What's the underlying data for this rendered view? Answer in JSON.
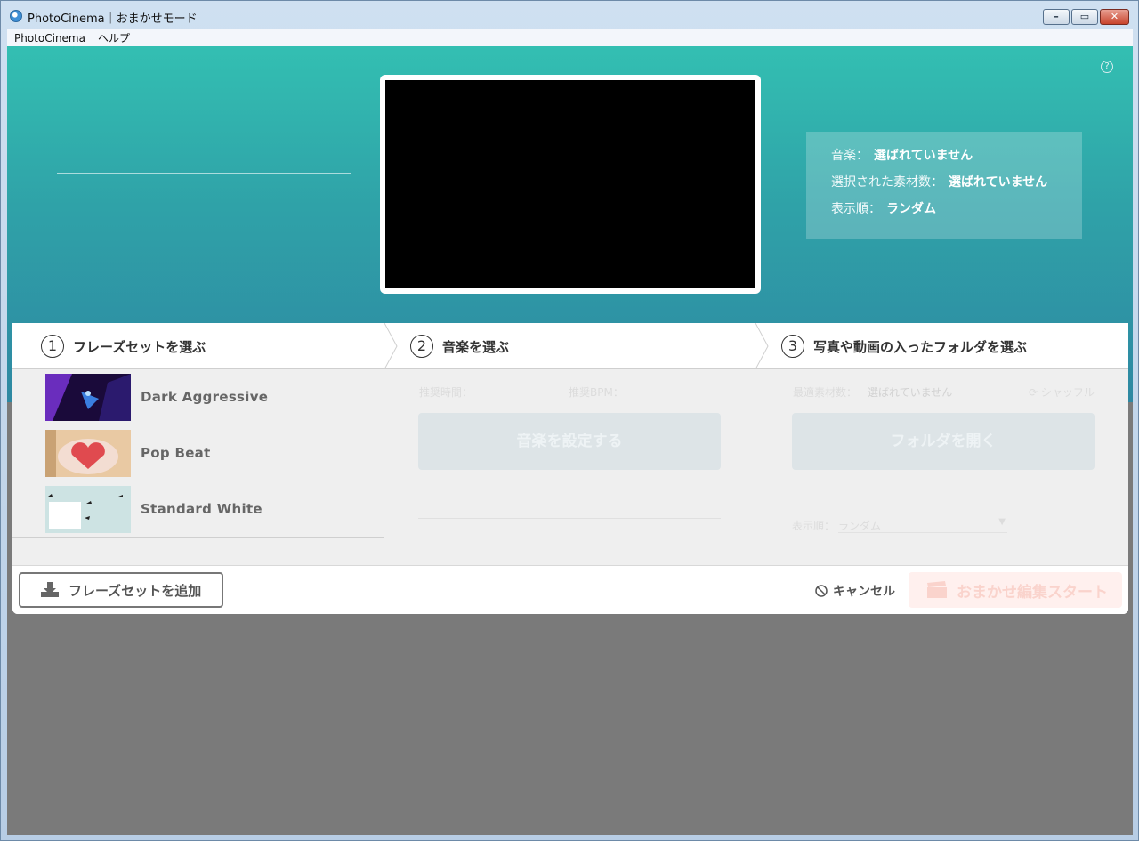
{
  "window": {
    "title": "PhotoCinema｜おまかせモード"
  },
  "menu": {
    "items": [
      "PhotoCinema",
      "ヘルプ"
    ]
  },
  "hero": {
    "help": "?",
    "info": {
      "music_label": "音楽：",
      "music_value": "選ばれていません",
      "count_label": "選択された素材数：",
      "count_value": "選ばれていません",
      "order_label": "表示順：",
      "order_value": "ランダム"
    }
  },
  "steps": [
    {
      "num": "1",
      "label": "フレーズセットを選ぶ"
    },
    {
      "num": "2",
      "label": "音楽を選ぶ"
    },
    {
      "num": "3",
      "label": "写真や動画の入ったフォルダを選ぶ"
    }
  ],
  "phrases": [
    {
      "label": "Dark Aggressive"
    },
    {
      "label": "Pop Beat"
    },
    {
      "label": "Standard White"
    }
  ],
  "music": {
    "time_label": "推奨時間：",
    "bpm_label": "推奨BPM：",
    "set_button": "音楽を設定する"
  },
  "folder": {
    "count_label": "最適素材数：",
    "count_value": "選ばれていません",
    "shuffle": "シャッフル",
    "open_button": "フォルダを開く",
    "order_label": "表示順：",
    "order_value": "ランダム"
  },
  "footer": {
    "add_button": "フレーズセットを追加",
    "cancel": "キャンセル",
    "start": "おまかせ編集スタート"
  },
  "colors": {
    "hero_top": "#33bfb2",
    "hero_bottom": "#2e88a2",
    "start_bg": "#fff0ee"
  }
}
